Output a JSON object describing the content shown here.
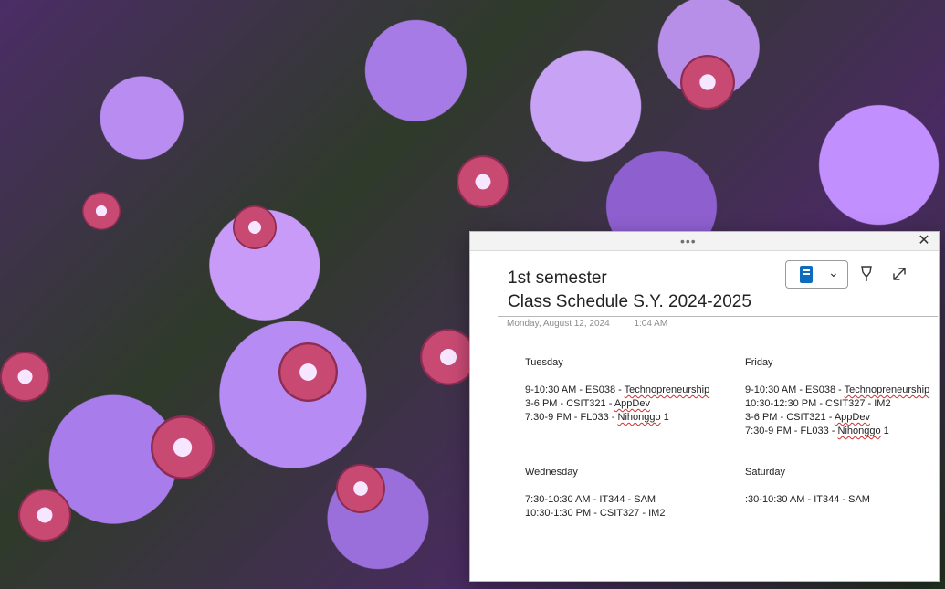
{
  "window": {
    "drag_handle": "•••",
    "close_glyph": "✕",
    "dropdown_glyph": "⌄"
  },
  "note": {
    "title_line1": "1st semester",
    "title_line2": "Class Schedule S.Y. 2024-2025",
    "date": "Monday, August 12, 2024",
    "time": "1:04 AM"
  },
  "schedule": {
    "tuesday": {
      "day": "Tuesday",
      "entries": [
        {
          "time": "9-10:30 AM - ES038 - ",
          "subject": "Technopreneurship"
        },
        {
          "time": "3-6 PM - CSIT321 - ",
          "subject": "AppDev"
        },
        {
          "time": "7:30-9 PM - FL033 - ",
          "subject": "Nihonggo",
          "suffix": " 1"
        }
      ]
    },
    "friday": {
      "day": "Friday",
      "entries": [
        {
          "time": "9-10:30 AM - ES038 - ",
          "subject": "Technopreneurship"
        },
        {
          "time": "10:30-12:30 PM - CSIT327 - IM2"
        },
        {
          "time": "3-6 PM - CSIT321 - ",
          "subject": "AppDev"
        },
        {
          "time": "7:30-9 PM - FL033 - ",
          "subject": "Nihonggo",
          "suffix": " 1"
        }
      ]
    },
    "wednesday": {
      "day": "Wednesday",
      "entries": [
        {
          "time": "7:30-10:30 AM - IT344 - SAM"
        },
        {
          "time": "10:30-1:30 PM - CSIT327 - IM2"
        }
      ]
    },
    "saturday": {
      "day": "Saturday",
      "entries": [
        {
          "time": ":30-10:30 AM - IT344 - SAM"
        }
      ]
    }
  }
}
